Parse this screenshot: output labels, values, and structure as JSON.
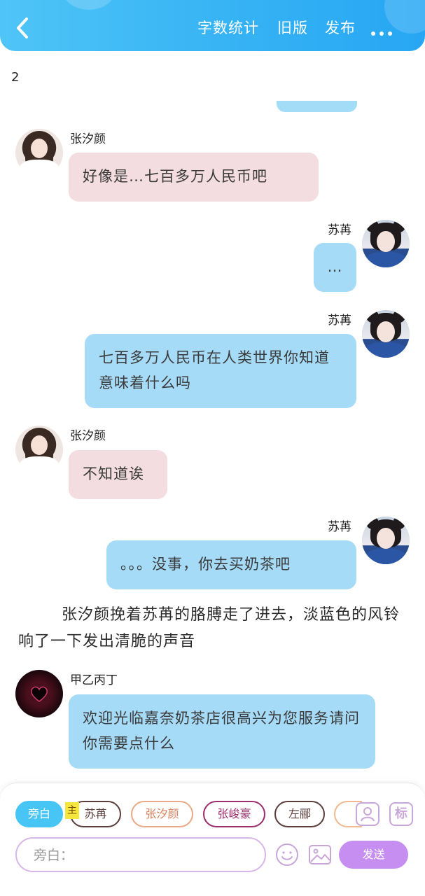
{
  "header": {
    "word_count_label": "字数统计",
    "old_version_label": "旧版",
    "publish_label": "发布"
  },
  "page_number": "2",
  "messages": [
    {
      "speaker": "张汐颜",
      "side": "left",
      "text": "好像是…七百多万人民币吧"
    },
    {
      "speaker": "苏苒",
      "side": "right",
      "text": "…"
    },
    {
      "speaker": "苏苒",
      "side": "right",
      "text": "七百多万人民币在人类世界你知道意味着什么吗"
    },
    {
      "speaker": "张汐颜",
      "side": "left",
      "text": "不知道诶"
    },
    {
      "speaker": "苏苒",
      "side": "right",
      "text": "。。。没事，你去买奶茶吧"
    },
    {
      "speaker": "甲乙丙丁",
      "side": "left",
      "text": "欢迎光临嘉奈奶茶店很高兴为您服务请问你需要点什么"
    }
  ],
  "narration": "张汐颜挽着苏苒的胳膊走了进去，淡蓝色的风铃响了一下发出清脆的声音",
  "composer": {
    "chips": [
      "旁白",
      "苏苒",
      "张汐颜",
      "张峻豪",
      "左郦"
    ],
    "main_badge": "主",
    "tag_label": "标",
    "input_placeholder": "旁白：",
    "send_label": "发送"
  },
  "colors": {
    "header_blue": "#36b3f4",
    "bubble_blue": "#a6dbf8",
    "bubble_pink": "#f3dde0",
    "send_purple": "#c68ef0"
  }
}
